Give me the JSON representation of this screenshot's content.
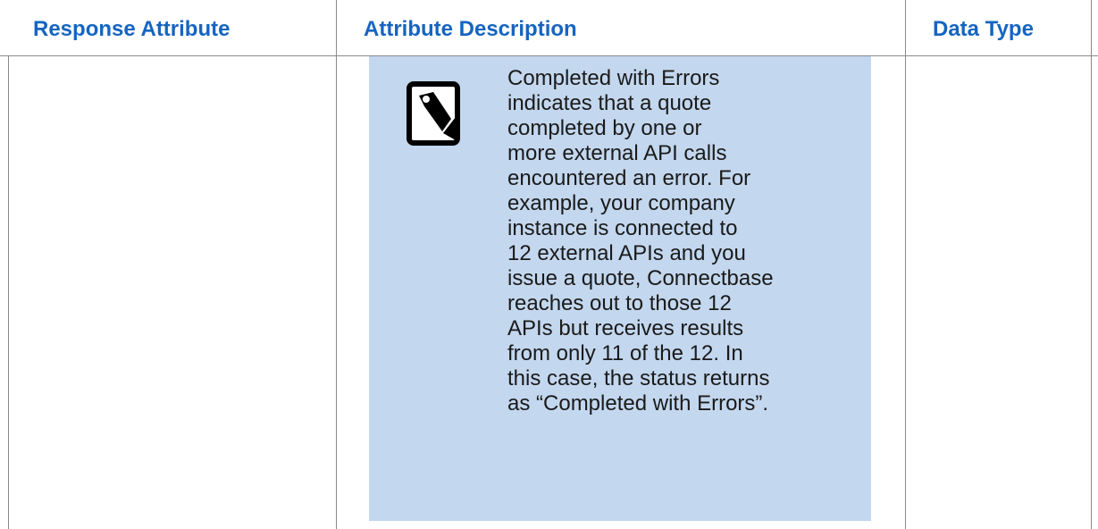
{
  "table": {
    "headers": {
      "response_attribute": "Response Attribute",
      "attribute_description": "Attribute Description",
      "data_type": "Data Type"
    },
    "row": {
      "response_attribute": "",
      "note": {
        "icon": "note-tag-icon",
        "text": "Completed with Errors\nindicates that a quote\ncompleted by one or\nmore external API calls\nencountered an error. For\nexample, your company\ninstance is connected to\n12 external APIs and you\nissue a quote, Connectbase\nreaches out to those 12\nAPIs but receives results\nfrom only 11 of the 12. In\nthis case, the status returns\nas “Completed with Errors”."
      },
      "data_type": ""
    }
  },
  "colors": {
    "header_text": "#1565c0",
    "note_background": "#c3d7ee",
    "grid_lines": "#8a8a8a"
  }
}
